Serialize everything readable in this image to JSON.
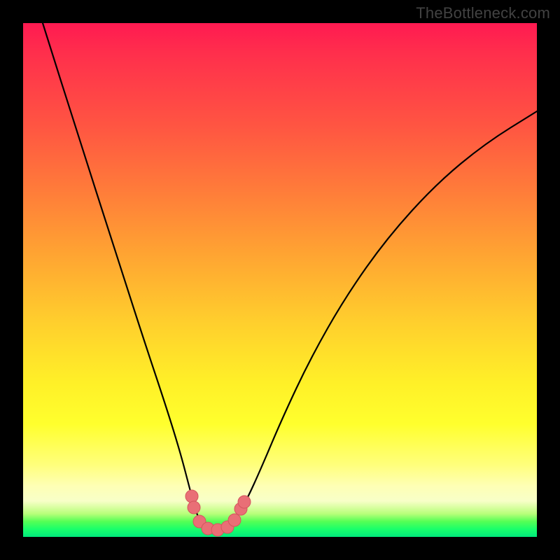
{
  "watermark": "TheBottleneck.com",
  "colors": {
    "frame": "#000000",
    "watermark": "#4a4a4a",
    "curve_stroke": "#000000",
    "bead_fill": "#e96f76",
    "bead_stroke": "#d3565d",
    "gradient_stops": [
      {
        "pos": 0.0,
        "hex": "#ff1a51"
      },
      {
        "pos": 0.06,
        "hex": "#ff2f4c"
      },
      {
        "pos": 0.2,
        "hex": "#ff5542"
      },
      {
        "pos": 0.32,
        "hex": "#ff7a3a"
      },
      {
        "pos": 0.45,
        "hex": "#ffa432"
      },
      {
        "pos": 0.58,
        "hex": "#ffce2d"
      },
      {
        "pos": 0.7,
        "hex": "#fff028"
      },
      {
        "pos": 0.78,
        "hex": "#ffff2d"
      },
      {
        "pos": 0.86,
        "hex": "#ffff7c"
      },
      {
        "pos": 0.9,
        "hex": "#feffb4"
      },
      {
        "pos": 0.93,
        "hex": "#f8ffc8"
      },
      {
        "pos": 0.955,
        "hex": "#b8ff7a"
      },
      {
        "pos": 0.97,
        "hex": "#55ff55"
      },
      {
        "pos": 0.985,
        "hex": "#19ff6b"
      },
      {
        "pos": 1.0,
        "hex": "#00e87c"
      }
    ]
  },
  "chart_data": {
    "type": "line",
    "title": "",
    "xlabel": "",
    "ylabel": "",
    "xlim": [
      0,
      734
    ],
    "ylim_svg_top_to_bottom": [
      0,
      734
    ],
    "series": [
      {
        "name": "left-branch",
        "points": [
          {
            "x": 28,
            "y": 0
          },
          {
            "x": 80,
            "y": 165
          },
          {
            "x": 130,
            "y": 320
          },
          {
            "x": 170,
            "y": 445
          },
          {
            "x": 205,
            "y": 550
          },
          {
            "x": 225,
            "y": 615
          },
          {
            "x": 238,
            "y": 665
          },
          {
            "x": 246,
            "y": 695
          },
          {
            "x": 252,
            "y": 710
          },
          {
            "x": 258,
            "y": 718
          },
          {
            "x": 266,
            "y": 722
          },
          {
            "x": 276,
            "y": 724
          }
        ]
      },
      {
        "name": "right-branch",
        "points": [
          {
            "x": 276,
            "y": 724
          },
          {
            "x": 286,
            "y": 722
          },
          {
            "x": 296,
            "y": 716
          },
          {
            "x": 306,
            "y": 704
          },
          {
            "x": 320,
            "y": 680
          },
          {
            "x": 340,
            "y": 636
          },
          {
            "x": 370,
            "y": 565
          },
          {
            "x": 410,
            "y": 480
          },
          {
            "x": 460,
            "y": 392
          },
          {
            "x": 520,
            "y": 307
          },
          {
            "x": 590,
            "y": 230
          },
          {
            "x": 660,
            "y": 172
          },
          {
            "x": 734,
            "y": 126
          }
        ]
      }
    ],
    "markers": [
      {
        "x": 241,
        "y": 676,
        "r": 9
      },
      {
        "x": 244,
        "y": 692,
        "r": 9
      },
      {
        "x": 252,
        "y": 712,
        "r": 9
      },
      {
        "x": 264,
        "y": 722,
        "r": 9
      },
      {
        "x": 278,
        "y": 724,
        "r": 9
      },
      {
        "x": 292,
        "y": 720,
        "r": 9
      },
      {
        "x": 302,
        "y": 710,
        "r": 9
      },
      {
        "x": 311,
        "y": 694,
        "r": 9
      },
      {
        "x": 316,
        "y": 684,
        "r": 9
      }
    ]
  }
}
